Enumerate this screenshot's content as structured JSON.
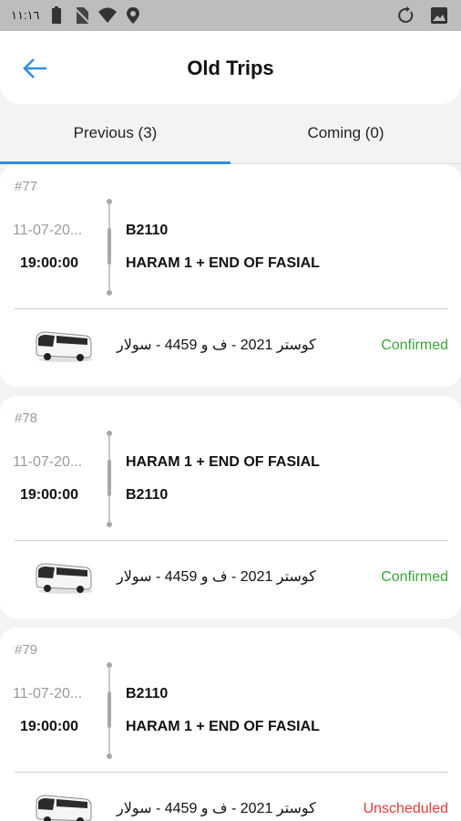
{
  "status_bar": {
    "time": "١١:١٦"
  },
  "header": {
    "title": "Old Trips"
  },
  "tabs": [
    {
      "label": "Previous (3)",
      "active": true
    },
    {
      "label": "Coming (0)",
      "active": false
    }
  ],
  "colors": {
    "accent": "#2f8de4",
    "confirmed": "#3aa63a",
    "unscheduled": "#e23b3b"
  },
  "trips": [
    {
      "number": "#77",
      "date": "11-07-20...",
      "time": "19:00:00",
      "stop1": "B2110",
      "stop2": "HARAM 1 + END OF FASIAL",
      "vehicle": "كوستر 2021 - ف و 4459 - سولار",
      "status": "Confirmed"
    },
    {
      "number": "#78",
      "date": "11-07-20...",
      "time": "19:00:00",
      "stop1": "HARAM 1 + END OF FASIAL",
      "stop2": "B2110",
      "vehicle": "كوستر 2021 - ف و 4459 - سولار",
      "status": "Confirmed"
    },
    {
      "number": "#79",
      "date": "11-07-20...",
      "time": "19:00:00",
      "stop1": "B2110",
      "stop2": "HARAM 1 + END OF FASIAL",
      "vehicle": "كوستر 2021 - ف و 4459 - سولار",
      "status": "Unscheduled"
    }
  ]
}
